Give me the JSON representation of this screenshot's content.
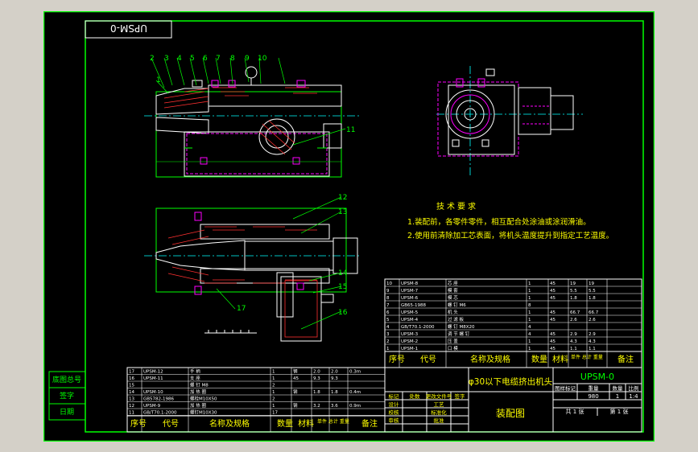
{
  "drawing_code_box": "UPSM-0",
  "title_code": "UPSM-0",
  "drawing_title": "φ30以下电缆挤出机头",
  "drawing_subtitle": "装配图",
  "scale": "1:4",
  "mass": "980",
  "sheet_count": "1",
  "sheet_index": "1",
  "sheets_label": "共 1 张",
  "sheet_label": "第 1 张",
  "title_headers": [
    "图样标记",
    "重量",
    "数量",
    "比例"
  ],
  "sign_headers": [
    "标记",
    "处数",
    "更改文件号",
    "签字",
    "日期"
  ],
  "sign_roles": [
    "设计",
    "校核",
    "审核",
    "工艺",
    "标准化",
    "批准"
  ],
  "left_block": [
    "底图总号",
    "签字",
    "日期"
  ],
  "tech_title": "技术要求",
  "tech_notes": [
    "1.装配前，各零件零件，相互配合处涂油或涂润滑油。",
    "2.使用前清除加工芯表面，将机头温度提升到指定工艺温度。"
  ],
  "leader_numbers": [
    "1",
    "2",
    "3",
    "4",
    "5",
    "6",
    "7",
    "8",
    "9",
    "10",
    "11",
    "12",
    "13",
    "14",
    "15",
    "16",
    "17"
  ],
  "bom_header": {
    "seq": "序号",
    "code": "代号",
    "name": "名称及规格",
    "qty": "数量",
    "material": "材料",
    "weight": "单件 总计 重量",
    "note": "备注"
  },
  "bom_right": [
    {
      "seq": "10",
      "code": "UPSM-8",
      "name": "芯 座",
      "qty": "1",
      "mat": "45",
      "w1": "19",
      "w2": "19"
    },
    {
      "seq": "9",
      "code": "UPSM-7",
      "name": "模 套",
      "qty": "1",
      "mat": "45",
      "w1": "5.5",
      "w2": "5.5"
    },
    {
      "seq": "8",
      "code": "UPSM-6",
      "name": "模 芯",
      "qty": "1",
      "mat": "45",
      "w1": "1.8",
      "w2": "1.8"
    },
    {
      "seq": "7",
      "code": "GB65-1988",
      "name": "螺 钉 M6",
      "qty": "8",
      "mat": "",
      "w1": "",
      "w2": ""
    },
    {
      "seq": "6",
      "code": "UPSM-5",
      "name": "机 头",
      "qty": "1",
      "mat": "45",
      "w1": "66.7",
      "w2": "66.7"
    },
    {
      "seq": "5",
      "code": "UPSM-4",
      "name": "过 滤 板",
      "qty": "1",
      "mat": "45",
      "w1": "2.6",
      "w2": "2.6"
    },
    {
      "seq": "4",
      "code": "GB/T70.1-2000",
      "name": "螺 钉 M8X20",
      "qty": "4",
      "mat": "",
      "w1": "",
      "w2": ""
    },
    {
      "seq": "3",
      "code": "UPSM-3",
      "name": "调 节 螺 钉",
      "qty": "4",
      "mat": "45",
      "w1": "2.9",
      "w2": "2.9"
    },
    {
      "seq": "2",
      "code": "UPSM-2",
      "name": "压 盖",
      "qty": "1",
      "mat": "45",
      "w1": "4.3",
      "w2": "4.3"
    },
    {
      "seq": "1",
      "code": "UPSM-1",
      "name": "口 模",
      "qty": "1",
      "mat": "45",
      "w1": "1.1",
      "w2": "1.1"
    }
  ],
  "bom_left": [
    {
      "seq": "17",
      "code": "UPSM-12",
      "name": "手 柄",
      "qty": "1",
      "mat": "钢",
      "w1": "2.0",
      "w2": "2.0",
      "note": "0.3m"
    },
    {
      "seq": "16",
      "code": "UPSM-11",
      "name": "支 座",
      "qty": "1",
      "mat": "45",
      "w1": "9.3",
      "w2": "9.3",
      "note": ""
    },
    {
      "seq": "15",
      "code": "",
      "name": "螺 钉 M8",
      "qty": "2",
      "mat": "",
      "w1": "",
      "w2": "",
      "note": ""
    },
    {
      "seq": "14",
      "code": "UPSM-10",
      "name": "加 热 圈",
      "qty": "1",
      "mat": "钢",
      "w1": "1.8",
      "w2": "1.8",
      "note": "0.4m"
    },
    {
      "seq": "13",
      "code": "GB5782-1986",
      "name": "螺栓M10X50",
      "qty": "2",
      "mat": "",
      "w1": "",
      "w2": "",
      "note": ""
    },
    {
      "seq": "12",
      "code": "UPSM-9",
      "name": "加 热 圈",
      "qty": "1",
      "mat": "钢",
      "w1": "3.2",
      "w2": "3.6",
      "note": "0.9m"
    },
    {
      "seq": "11",
      "code": "GB/T70.1-2000",
      "name": "螺钉M10X30",
      "qty": "17",
      "mat": "",
      "w1": "",
      "w2": "",
      "note": ""
    }
  ],
  "colors": {
    "frame": "#00ff00",
    "outline": "#ffffff",
    "hatch": "#ff3030",
    "dim": "#ff00ff",
    "center": "#00ffff",
    "text": "#ffff00",
    "background": "#000000",
    "page": "#d4d0c8"
  }
}
